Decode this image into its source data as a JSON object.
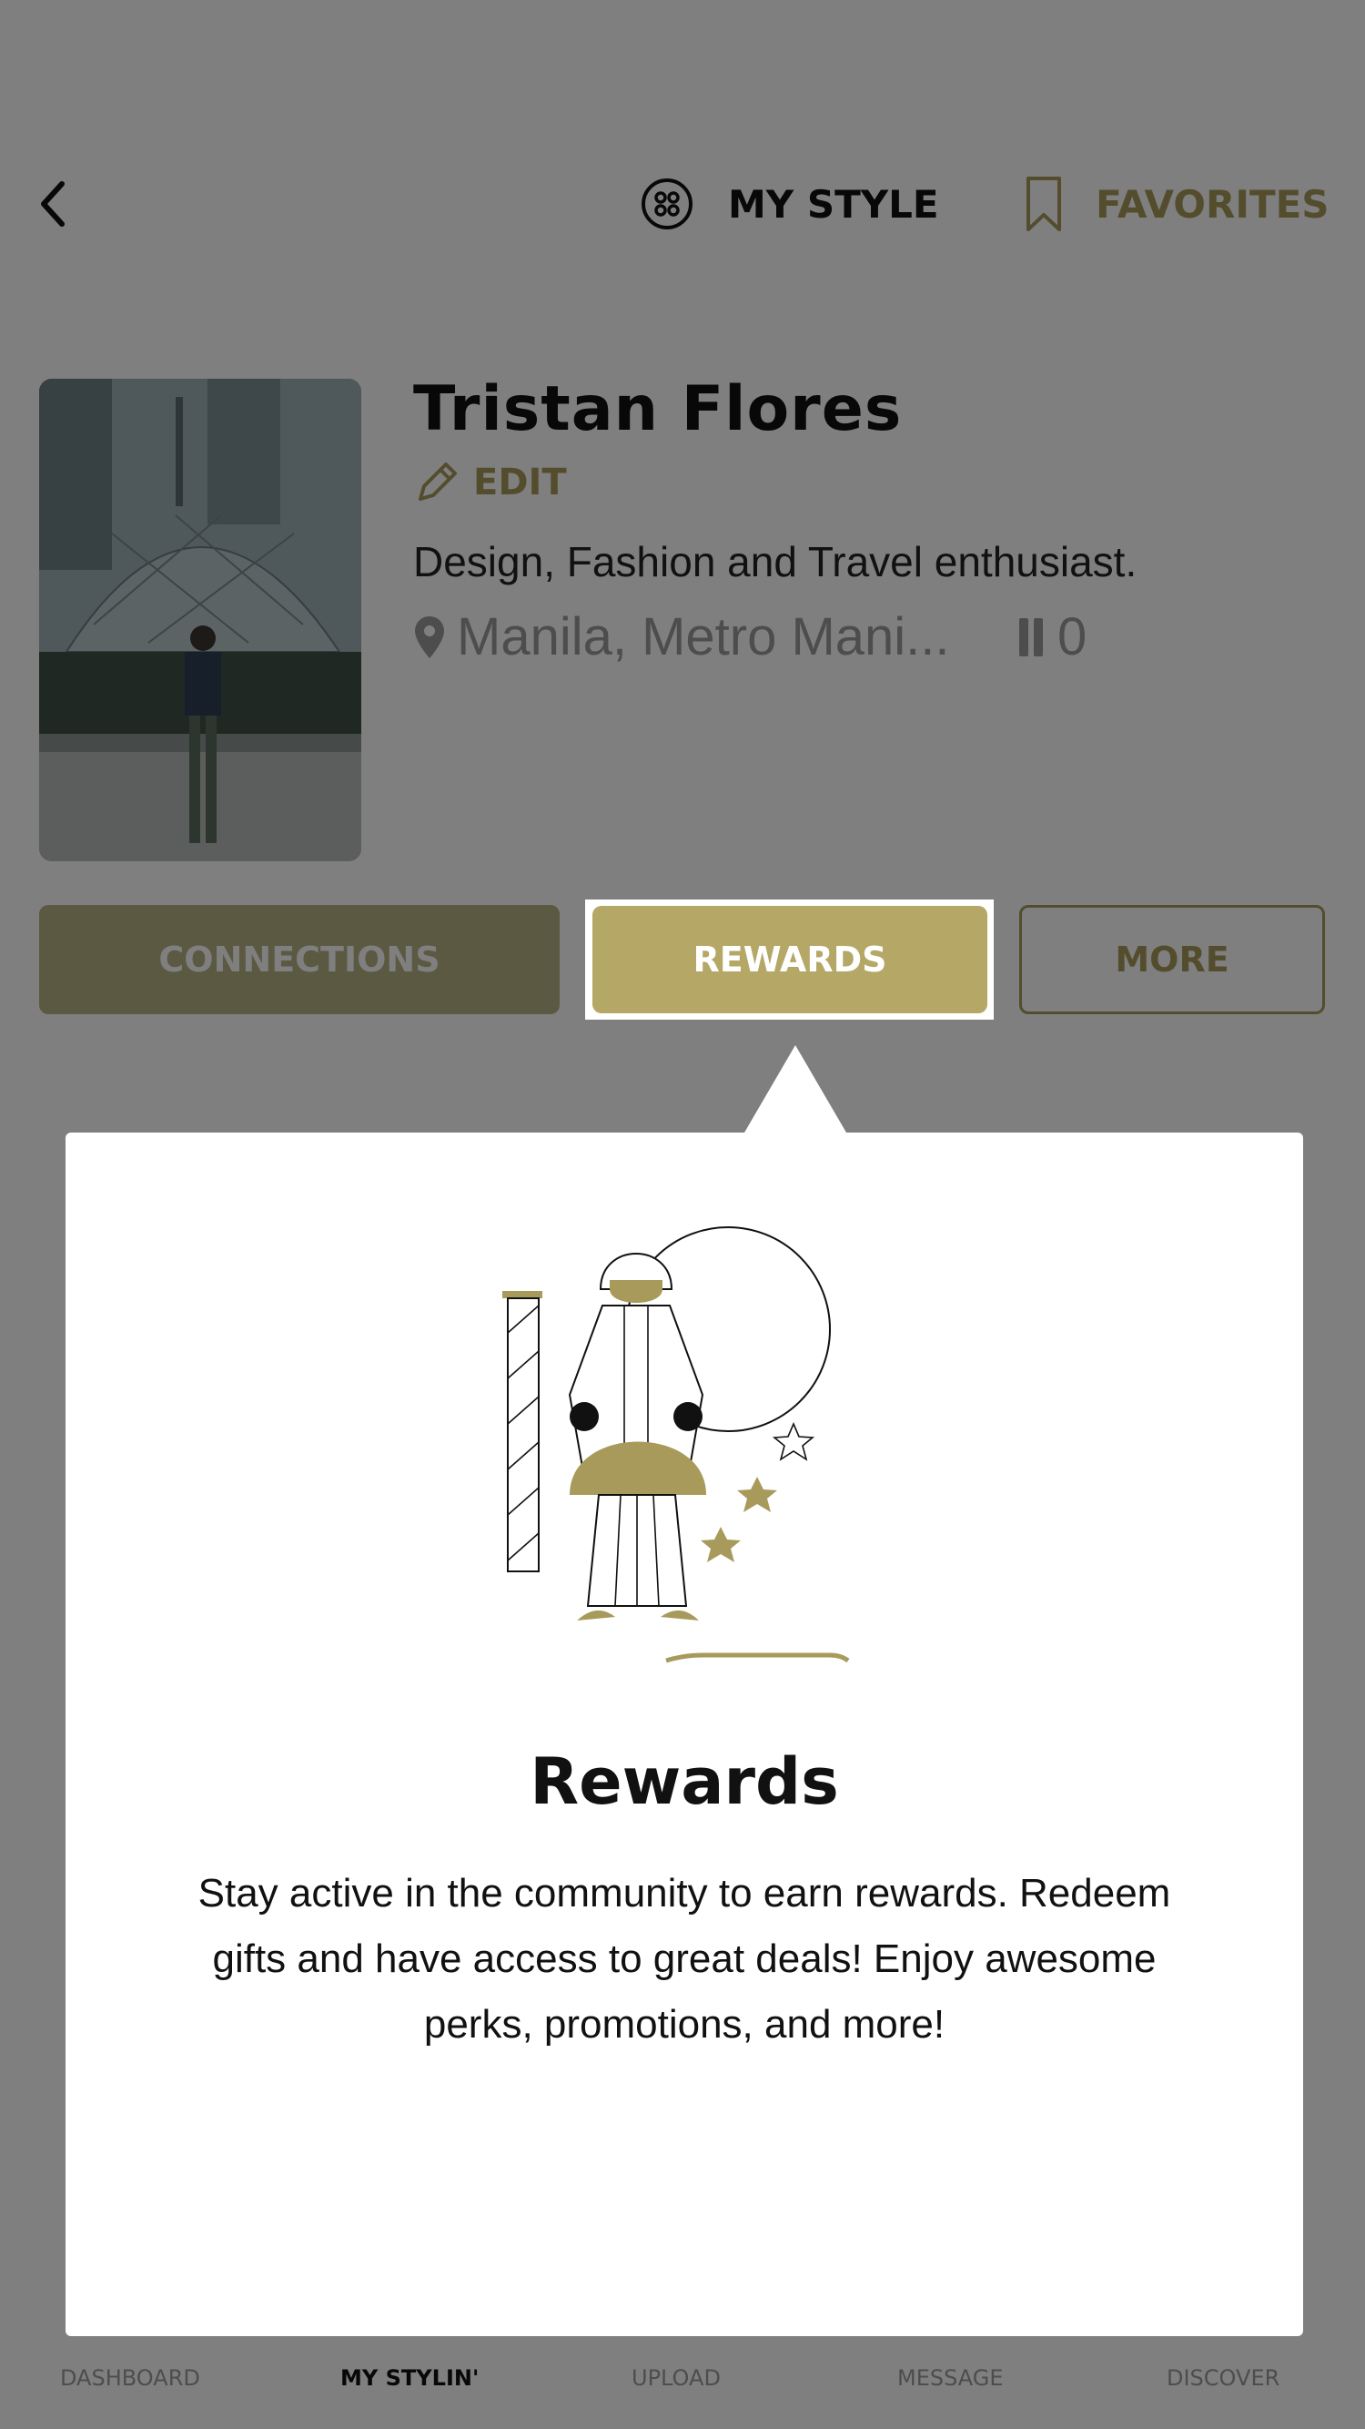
{
  "header": {
    "back_icon": "chevron-left-icon",
    "my_style_icon": "grid-circle-icon",
    "my_style_label": "MY STYLE",
    "favorites_icon": "bookmark-icon",
    "favorites_label": "FAVORITES"
  },
  "profile": {
    "name": "Tristan Flores",
    "edit_label": "EDIT",
    "bio": "Design, Fashion and Travel enthusiast.",
    "location": "Manila, Metro Mani...",
    "followers_count": "0"
  },
  "actions": {
    "connections": "CONNECTIONS",
    "rewards": "REWARDS",
    "more": "MORE"
  },
  "popup": {
    "title": "Rewards",
    "body": "Stay active in the community to earn rewards. Redeem gifts and have access to great deals! Enjoy awesome perks, promotions, and more!"
  },
  "bottom_nav": {
    "dashboard": "DASHBOARD",
    "my_stylin": "MY STYLIN'",
    "upload": "UPLOAD",
    "message": "MESSAGE",
    "discover": "DISCOVER"
  },
  "colors": {
    "accent": "#a89a5b",
    "dark_accent": "#b8b287"
  }
}
